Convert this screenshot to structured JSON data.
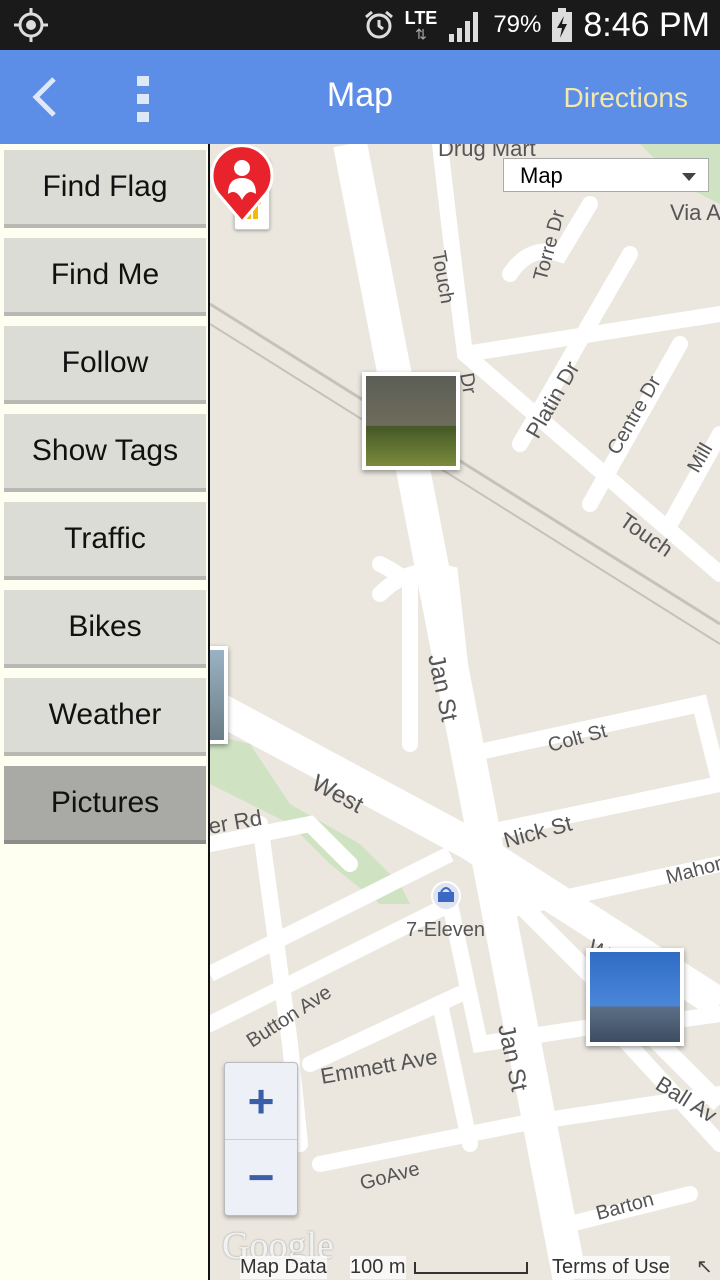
{
  "status_bar": {
    "network": "LTE",
    "battery": "79%",
    "time": "8:46 PM"
  },
  "action_bar": {
    "title": "Map",
    "directions_label": "Directions"
  },
  "sidebar": {
    "items": [
      {
        "label": "Find Flag"
      },
      {
        "label": "Find Me"
      },
      {
        "label": "Follow"
      },
      {
        "label": "Show Tags"
      },
      {
        "label": "Traffic"
      },
      {
        "label": "Bikes"
      },
      {
        "label": "Weather"
      },
      {
        "label": "Pictures",
        "active": true
      }
    ]
  },
  "map": {
    "map_type_selected": "Map",
    "labels": {
      "drug_mart": "Drug Mart",
      "via_a": "Via A",
      "touch_1": "Touch",
      "torre_dr": "Torre Dr",
      "dr": "Dr",
      "platin_dr": "Platin Dr",
      "centre_dr": "Centre Dr",
      "mill": "Mill",
      "touch_2": "Touch",
      "jan_st_1": "Jan St",
      "colt_st": "Colt St",
      "west": "West",
      "nick_st": "Nick St",
      "mahon": "Mahon",
      "er_rd": "er Rd",
      "seven_eleven": "7-Eleven",
      "west_end": "West End",
      "button_ave": "Button Ave",
      "emmett_ave": "Emmett Ave",
      "jan_st_2": "Jan St",
      "ball_av": "Ball Av",
      "go_ave": "GoAve",
      "barton": "Barton"
    },
    "zoom_in": "+",
    "zoom_out": "−",
    "logo": "Google",
    "footer": {
      "map_data": "Map Data",
      "scale": "100 m",
      "terms": "Terms of Use"
    }
  },
  "colors": {
    "action_bar": "#5c8ee8",
    "directions": "#f3e8a9",
    "sidebar_bg": "#fefff0",
    "button": "#dcdcd6",
    "button_active": "#a9a9a6",
    "marker": "#e8232b"
  },
  "icons": [
    "gps-icon",
    "alarm-icon",
    "signal-icon",
    "battery-icon",
    "back-icon",
    "overflow-menu-icon",
    "pegman-icon",
    "dropdown-arrow-icon",
    "location-marker-icon",
    "store-icon",
    "expand-icon"
  ]
}
